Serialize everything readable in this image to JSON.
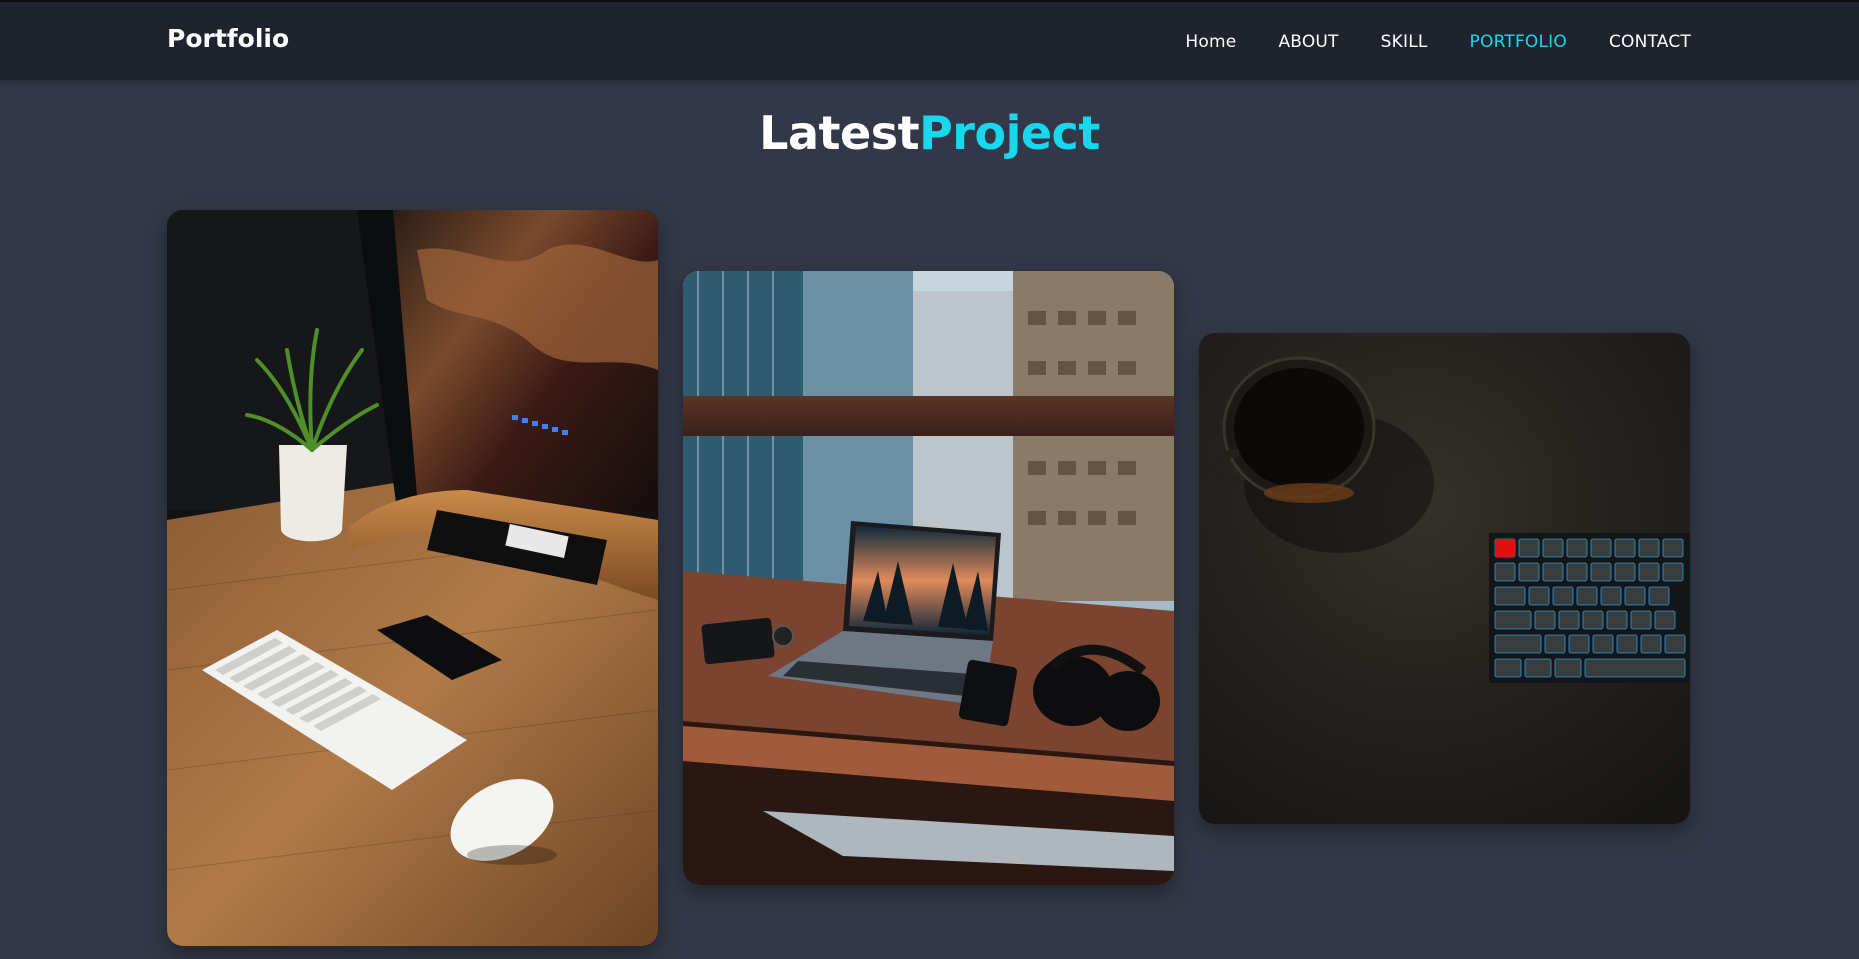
{
  "nav": {
    "brand": "Portfolio",
    "links": [
      {
        "label": "Home",
        "active": false
      },
      {
        "label": "ABOUT",
        "active": false
      },
      {
        "label": "SKILL",
        "active": false
      },
      {
        "label": "PORTFOLIO",
        "active": true
      },
      {
        "label": "CONTACT",
        "active": false
      }
    ]
  },
  "section": {
    "title_part1": "Latest",
    "title_part2": "Project"
  },
  "projects": [
    {
      "image": "desk-setup-monitor-keyboard-mouse-photo"
    },
    {
      "image": "laptop-window-city-view-photo"
    },
    {
      "image": "coffee-cup-backlit-keyboard-photo"
    }
  ],
  "colors": {
    "accent": "#18d8ee",
    "page_bg": "#323847",
    "navbar_bg": "#1f232d",
    "text": "#ffffff"
  }
}
